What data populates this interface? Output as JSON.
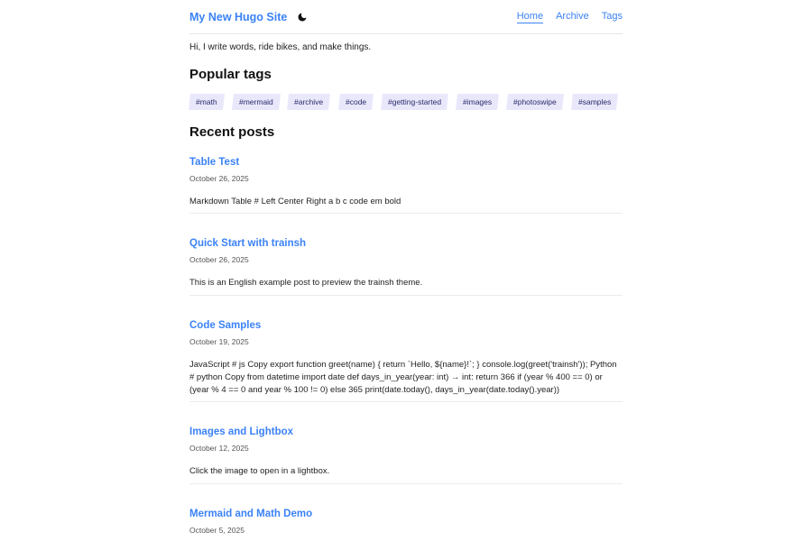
{
  "header": {
    "site_title": "My New Hugo Site",
    "theme_toggle_icon": "moon-icon",
    "nav": [
      {
        "label": "Home",
        "active": true
      },
      {
        "label": "Archive",
        "active": false
      },
      {
        "label": "Tags",
        "active": false
      }
    ]
  },
  "intro": "Hi, I write words, ride bikes, and make things.",
  "popular_tags": {
    "title": "Popular tags",
    "tags": [
      "#math",
      "#mermaid",
      "#archive",
      "#code",
      "#getting-started",
      "#images",
      "#photoswipe",
      "#samples"
    ]
  },
  "recent_posts": {
    "title": "Recent posts",
    "posts": [
      {
        "title": "Table Test",
        "date": "October 26, 2025",
        "excerpt": "Markdown Table # Left Center Right a b c code em bold"
      },
      {
        "title": "Quick Start with trainsh",
        "date": "October 26, 2025",
        "excerpt": "This is an English example post to preview the trainsh theme."
      },
      {
        "title": "Code Samples",
        "date": "October 19, 2025",
        "excerpt": "JavaScript # js Copy export function greet(name) { return `Hello, ${name}!`; } console.log(greet('trainsh')); Python # python Copy from datetime import date def days_in_year(year: int) → int: return 366 if (year % 400 == 0) or (year % 4 == 0 and year % 100 != 0) else 365 print(date.today(), days_in_year(date.today().year))"
      },
      {
        "title": "Images and Lightbox",
        "date": "October 12, 2025",
        "excerpt": "Click the image to open in a lightbox."
      },
      {
        "title": "Mermaid and Math Demo",
        "date": "October 5, 2025",
        "excerpt": ""
      }
    ]
  },
  "colors": {
    "link": "#3b82f6",
    "tag_bg": "#e9e8fb"
  }
}
